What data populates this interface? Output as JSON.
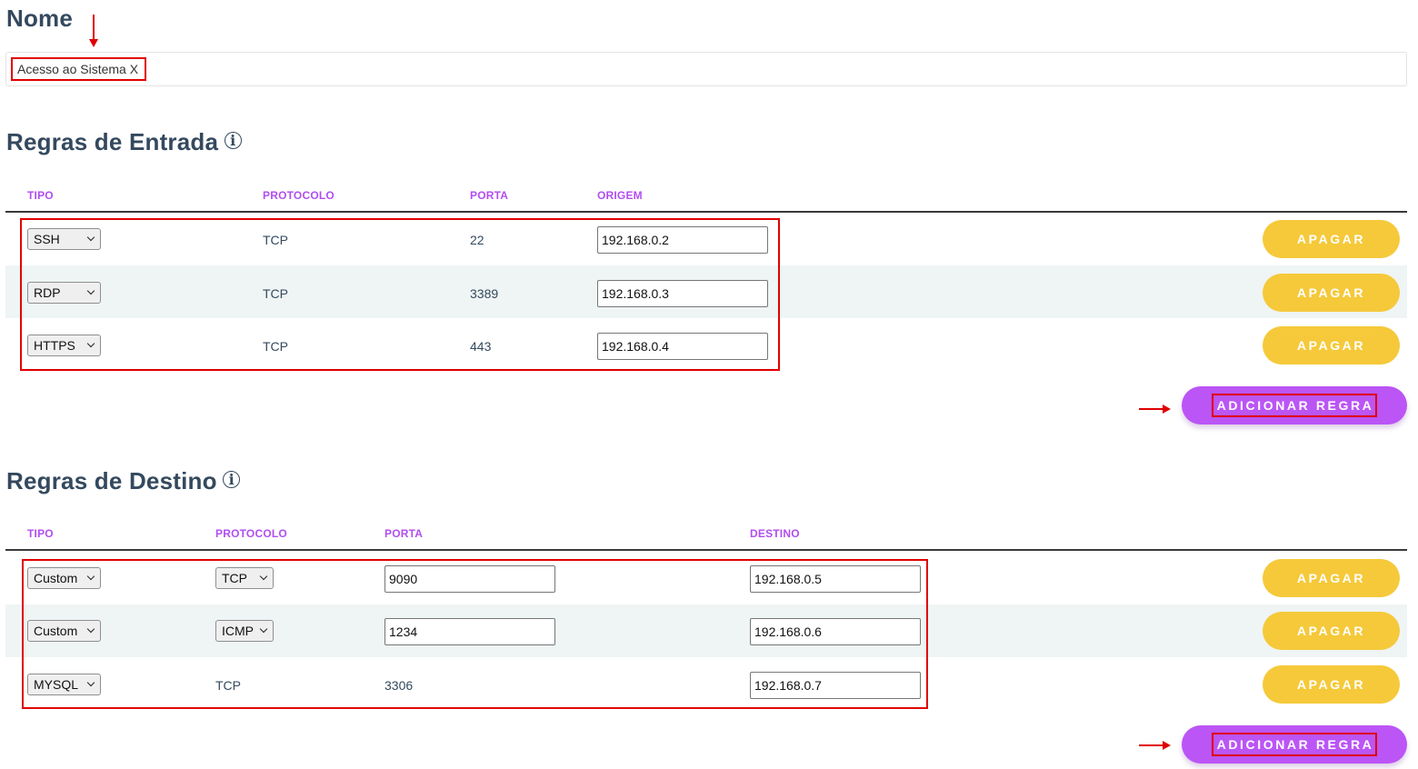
{
  "nome": {
    "title": "Nome",
    "value": "Acesso ao Sistema X"
  },
  "entrada": {
    "title": "Regras de Entrada",
    "info_icon": "info-icon",
    "headers": {
      "tipo": "TIPO",
      "protocolo": "PROTOCOLO",
      "porta": "PORTA",
      "origem": "ORIGEM"
    },
    "rows": [
      {
        "tipo": "SSH",
        "protocolo": "TCP",
        "porta": "22",
        "origem": "192.168.0.2",
        "delete": "APAGAR"
      },
      {
        "tipo": "RDP",
        "protocolo": "TCP",
        "porta": "3389",
        "origem": "192.168.0.3",
        "delete": "APAGAR"
      },
      {
        "tipo": "HTTPS",
        "protocolo": "TCP",
        "porta": "443",
        "origem": "192.168.0.4",
        "delete": "APAGAR"
      }
    ],
    "add_label": "ADICIONAR REGRA"
  },
  "destino": {
    "title": "Regras de Destino",
    "info_icon": "info-icon",
    "headers": {
      "tipo": "TIPO",
      "protocolo": "PROTOCOLO",
      "porta": "PORTA",
      "destino": "DESTINO"
    },
    "rows": [
      {
        "tipo": "Custom",
        "protocolo": "TCP",
        "porta": "9090",
        "destino": "192.168.0.5",
        "delete": "APAGAR"
      },
      {
        "tipo": "Custom",
        "protocolo": "ICMP",
        "porta": "1234",
        "destino": "192.168.0.6",
        "delete": "APAGAR"
      },
      {
        "tipo": "MYSQL",
        "protocolo": "TCP",
        "porta": "3306",
        "destino": "192.168.0.7",
        "delete": "APAGAR"
      }
    ],
    "add_label": "ADICIONAR REGRA"
  },
  "colors": {
    "heading": "#34495e",
    "column_header": "#b14ef0",
    "delete_button": "#f5c93a",
    "add_button": "#bb55f5",
    "annotation": "#e00000"
  }
}
